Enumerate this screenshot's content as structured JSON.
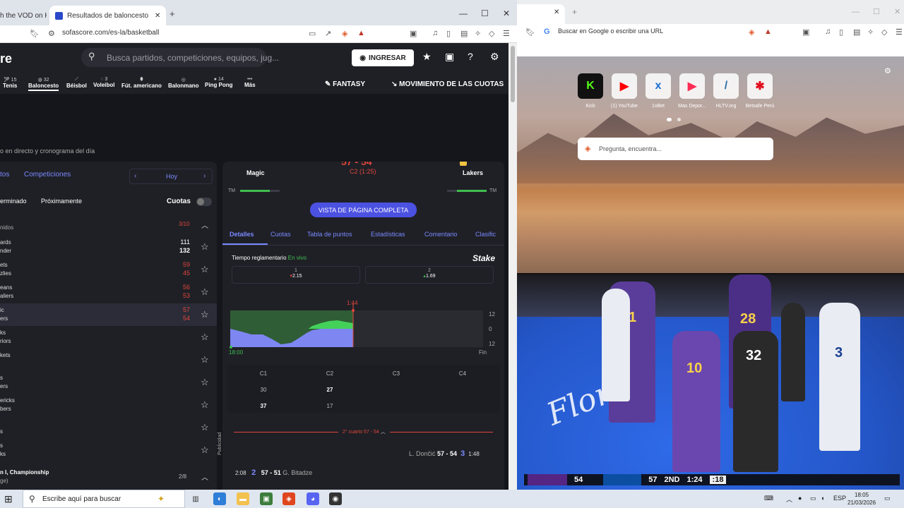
{
  "left_browser": {
    "tabs": [
      {
        "label": "h the VOD on Ki"
      },
      {
        "label": "Resultados de baloncesto en dir"
      }
    ],
    "url": "sofascore.com/es-la/basketball"
  },
  "sofascore": {
    "logo": "re",
    "search_placeholder": "Busca partidos, competiciones, equipos, jug...",
    "login_label": "INGRESAR",
    "sports": [
      {
        "count": "15",
        "label": "Tenis"
      },
      {
        "count": "32",
        "label": "Baloncesto"
      },
      {
        "count": "",
        "label": "Béisbol"
      },
      {
        "count": "3",
        "label": "Voleibol"
      },
      {
        "count": "",
        "label": "Fút. americano"
      },
      {
        "count": "",
        "label": "Balonmano"
      },
      {
        "count": "14",
        "label": "Ping Pong"
      },
      {
        "count": "",
        "label": "Más"
      }
    ],
    "fantasy_label": "FANTASY",
    "odds_movement_label": "MOVIMIENTO DE LAS CUOTAS",
    "subtitle": "o en directo y cronograma del día",
    "left_panel": {
      "tabs": [
        "tos",
        "Competiciones"
      ],
      "date_label": "Hoy",
      "filters": [
        "erminado",
        "Próximamente"
      ],
      "cuotas_label": "Cuotas",
      "group1": {
        "label": "nidos",
        "count": "3/10"
      },
      "matches": [
        {
          "t1": "ards",
          "t2": "nder",
          "s1": "111",
          "s2": "132",
          "live": false
        },
        {
          "t1": "ets",
          "t2": "zlies",
          "s1": "59",
          "s2": "45",
          "live": true
        },
        {
          "t1": "eans",
          "t2": "aliers",
          "s1": "56",
          "s2": "53",
          "live": true
        },
        {
          "t1": "ic",
          "t2": "ers",
          "s1": "57",
          "s2": "54",
          "live": true
        },
        {
          "t1": "ks",
          "t2": "riors",
          "s1": "",
          "s2": "",
          "live": false
        },
        {
          "t1": "kets",
          "t2": "",
          "s1": "",
          "s2": "",
          "live": false
        },
        {
          "t1": "s",
          "t2": "ers",
          "s1": "",
          "s2": "",
          "live": false
        },
        {
          "t1": "ericks",
          "t2": "bers",
          "s1": "",
          "s2": "",
          "live": false
        },
        {
          "t1": "",
          "t2": "s",
          "s1": "",
          "s2": "",
          "live": false
        },
        {
          "t1": "s",
          "t2": "ks",
          "s1": "",
          "s2": "",
          "live": false
        }
      ],
      "group2": {
        "label": "n I, Championship",
        "sub": "ge)",
        "count": "2/8"
      }
    },
    "match_detail": {
      "home": "Magic",
      "away": "Lakers",
      "score": "57 - 54",
      "period": "C2 (1:25)",
      "tm_label": "TM",
      "full_page_button": "VISTA DE PÁGINA COMPLETA",
      "tabs": [
        "Detalles",
        "Cuotas",
        "Tabla de puntos",
        "Estadísticas",
        "Comentario",
        "Clasific"
      ],
      "regulation_label": "Tiempo reglamentario",
      "live_label": "En vivo",
      "sponsor": "Stake",
      "odds": [
        {
          "label": "1",
          "value": "2.15",
          "trend": "down"
        },
        {
          "label": "2",
          "value": "1.69",
          "trend": "up"
        }
      ],
      "momentum": {
        "time_marker": "1:44",
        "start": "18:00",
        "end": "Fin",
        "y_ticks": [
          "12",
          "0",
          "12"
        ]
      },
      "quarters": {
        "headers": [
          "C1",
          "C2",
          "C3",
          "C4"
        ],
        "home": [
          "30",
          "27",
          "",
          ""
        ],
        "away": [
          "37",
          "17",
          "",
          ""
        ]
      },
      "quarter_section": "2° cuarto 57 - 54",
      "plays": [
        {
          "time": "1:48",
          "player": "L. Dončić",
          "score": "57 - 54",
          "points": "3"
        },
        {
          "time": "2:08",
          "player": "G. Bitadze",
          "score": "57 - 51",
          "points": "2"
        }
      ],
      "ad_label": "Publicidad"
    }
  },
  "right_browser": {
    "address_placeholder": "Buscar en Google o escribir una URL",
    "shortcuts": [
      {
        "label": "Kick",
        "glyph": "K",
        "color": "#53fc18"
      },
      {
        "label": "(1) YouTube",
        "glyph": "▶",
        "color": "#ff0000"
      },
      {
        "label": "1xBet",
        "glyph": "x",
        "color": "#1a6fd1"
      },
      {
        "label": "Mas Depor...",
        "glyph": "▶",
        "color": "#ff2d55"
      },
      {
        "label": "HLTV.org",
        "glyph": "/",
        "color": "#2b6ea6"
      },
      {
        "label": "Betsafe Perú",
        "glyph": "✱",
        "color": "#e10f1f"
      }
    ],
    "search_placeholder": "Pregunta, encuentra...",
    "video": {
      "court_text": "Florid",
      "jerseys": [
        "11",
        "28",
        "10",
        "32",
        "3"
      ],
      "scorebug": {
        "away_score": "54",
        "home_score": "57",
        "quarter": "2ND",
        "clock": "1:24",
        "shot_clock": ":18"
      }
    }
  },
  "taskbar": {
    "search_placeholder": "Escribe aquí para buscar",
    "lang": "ESP",
    "time": "18:05",
    "date": "21/03/2026"
  },
  "colors": {
    "sofascore_bg": "#15161b",
    "accent_blue": "#4b51e0",
    "live_red": "#e0463c",
    "positive_green": "#3fbf4f"
  }
}
